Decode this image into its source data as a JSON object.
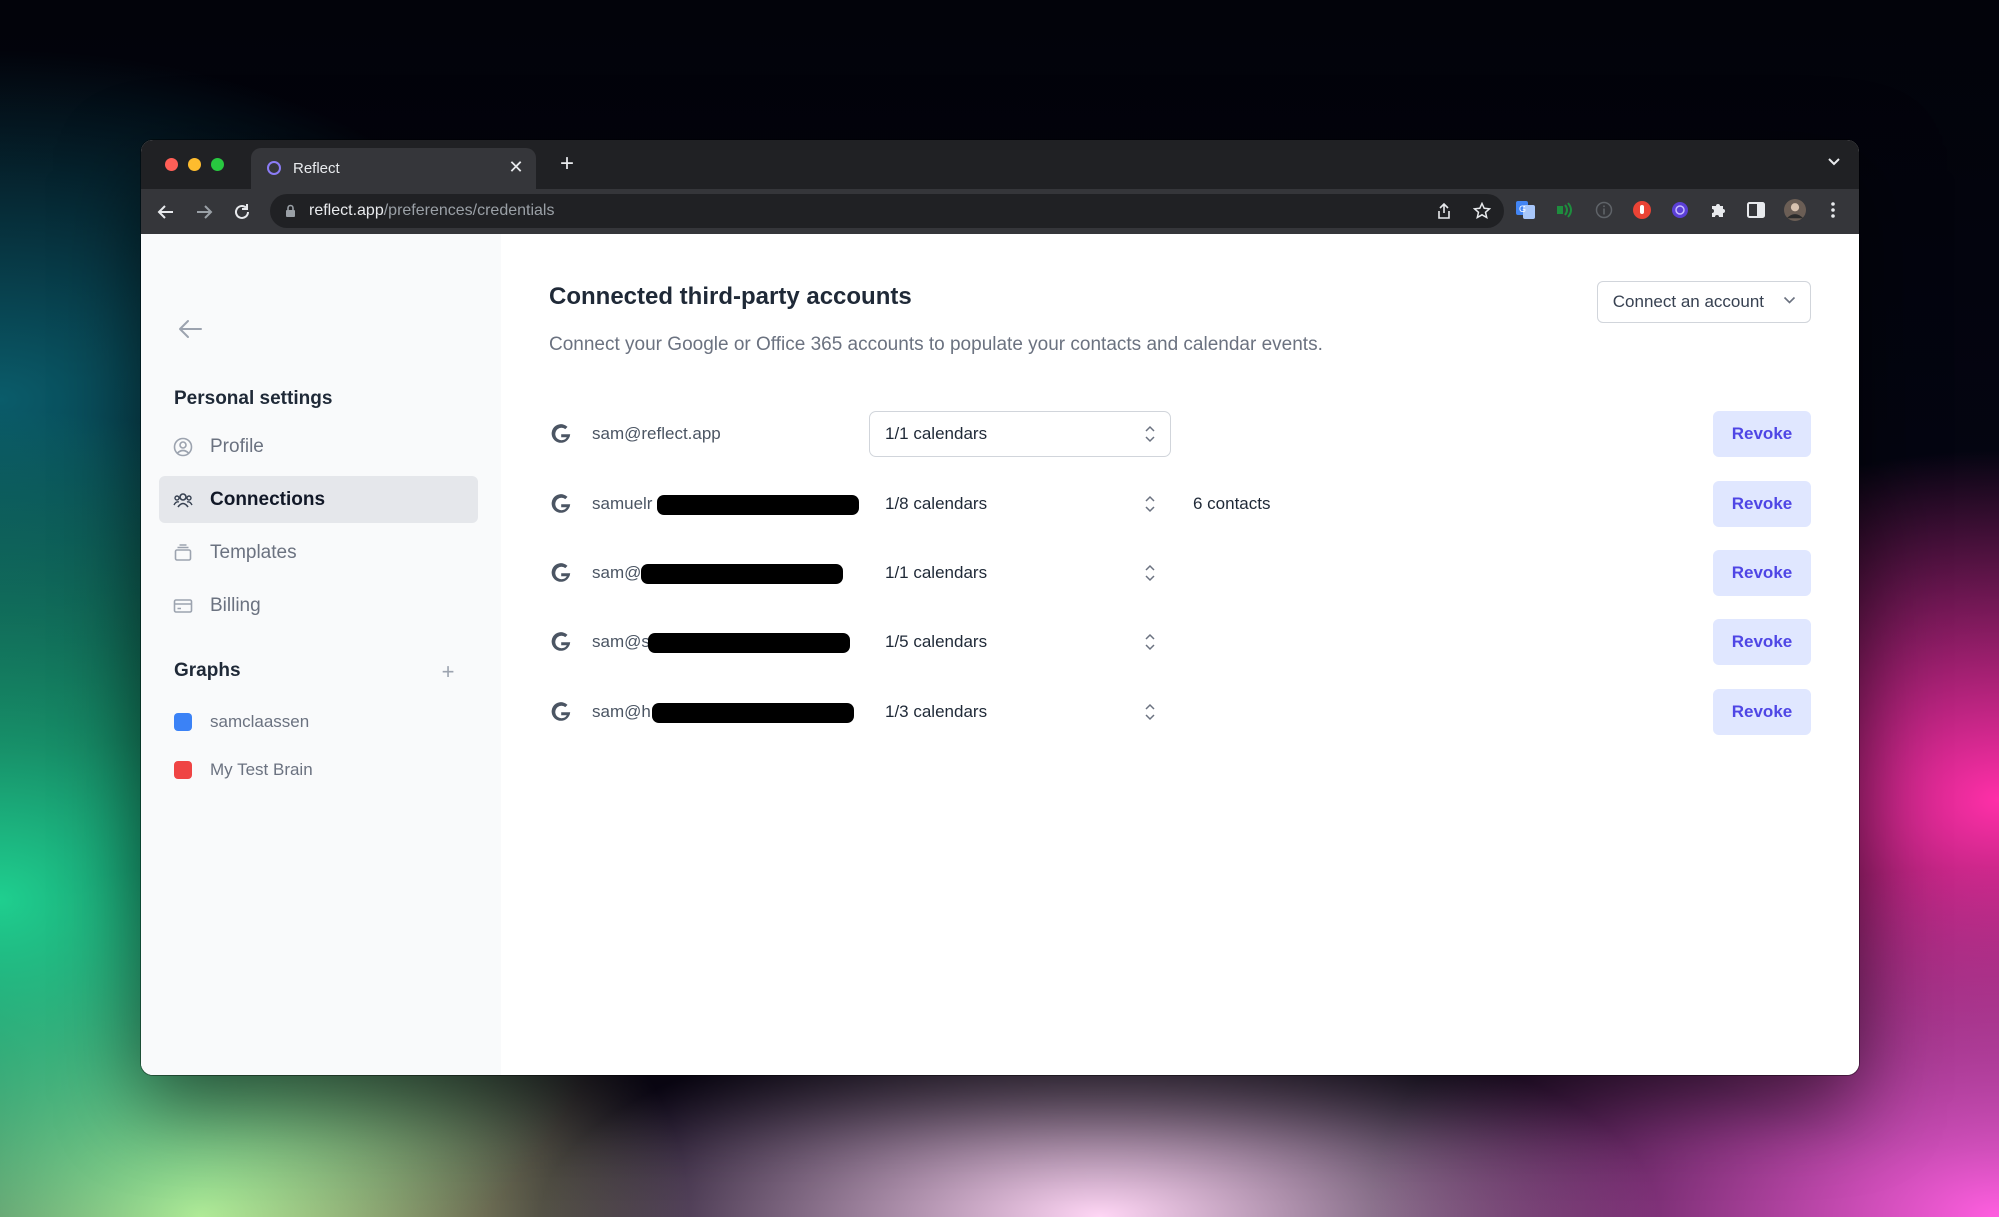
{
  "browser": {
    "tab_title": "Reflect",
    "url_host": "reflect.app",
    "url_path": "/preferences/credentials"
  },
  "sidebar": {
    "personal_settings_title": "Personal settings",
    "items": [
      {
        "label": "Profile",
        "icon": "user-circle-icon",
        "active": false
      },
      {
        "label": "Connections",
        "icon": "users-icon",
        "active": true
      },
      {
        "label": "Templates",
        "icon": "template-icon",
        "active": false
      },
      {
        "label": "Billing",
        "icon": "credit-card-icon",
        "active": false
      }
    ],
    "graphs_title": "Graphs",
    "graphs": [
      {
        "label": "samclaassen",
        "color": "#3b82f6"
      },
      {
        "label": "My Test Brain",
        "color": "#ef4444"
      }
    ]
  },
  "main": {
    "title": "Connected third-party accounts",
    "subtitle": "Connect your Google or Office 365 accounts to populate your contacts and calendar events.",
    "connect_button": "Connect an account",
    "accounts": [
      {
        "email": "sam@reflect.app",
        "calendars": "1/1 calendars",
        "contacts": "",
        "revoke": "Revoke"
      },
      {
        "email": "samuelr",
        "calendars": "1/8 calendars",
        "contacts": "6 contacts",
        "revoke": "Revoke"
      },
      {
        "email": "sam@",
        "calendars": "1/1 calendars",
        "contacts": "",
        "revoke": "Revoke"
      },
      {
        "email": "sam@s",
        "calendars": "1/5 calendars",
        "contacts": "",
        "revoke": "Revoke"
      },
      {
        "email": "sam@h",
        "calendars": "1/3 calendars",
        "contacts": "",
        "revoke": "Revoke"
      }
    ]
  },
  "colors": {
    "accent": "#4f46e5",
    "revoke_bg": "#e0e7ff"
  }
}
